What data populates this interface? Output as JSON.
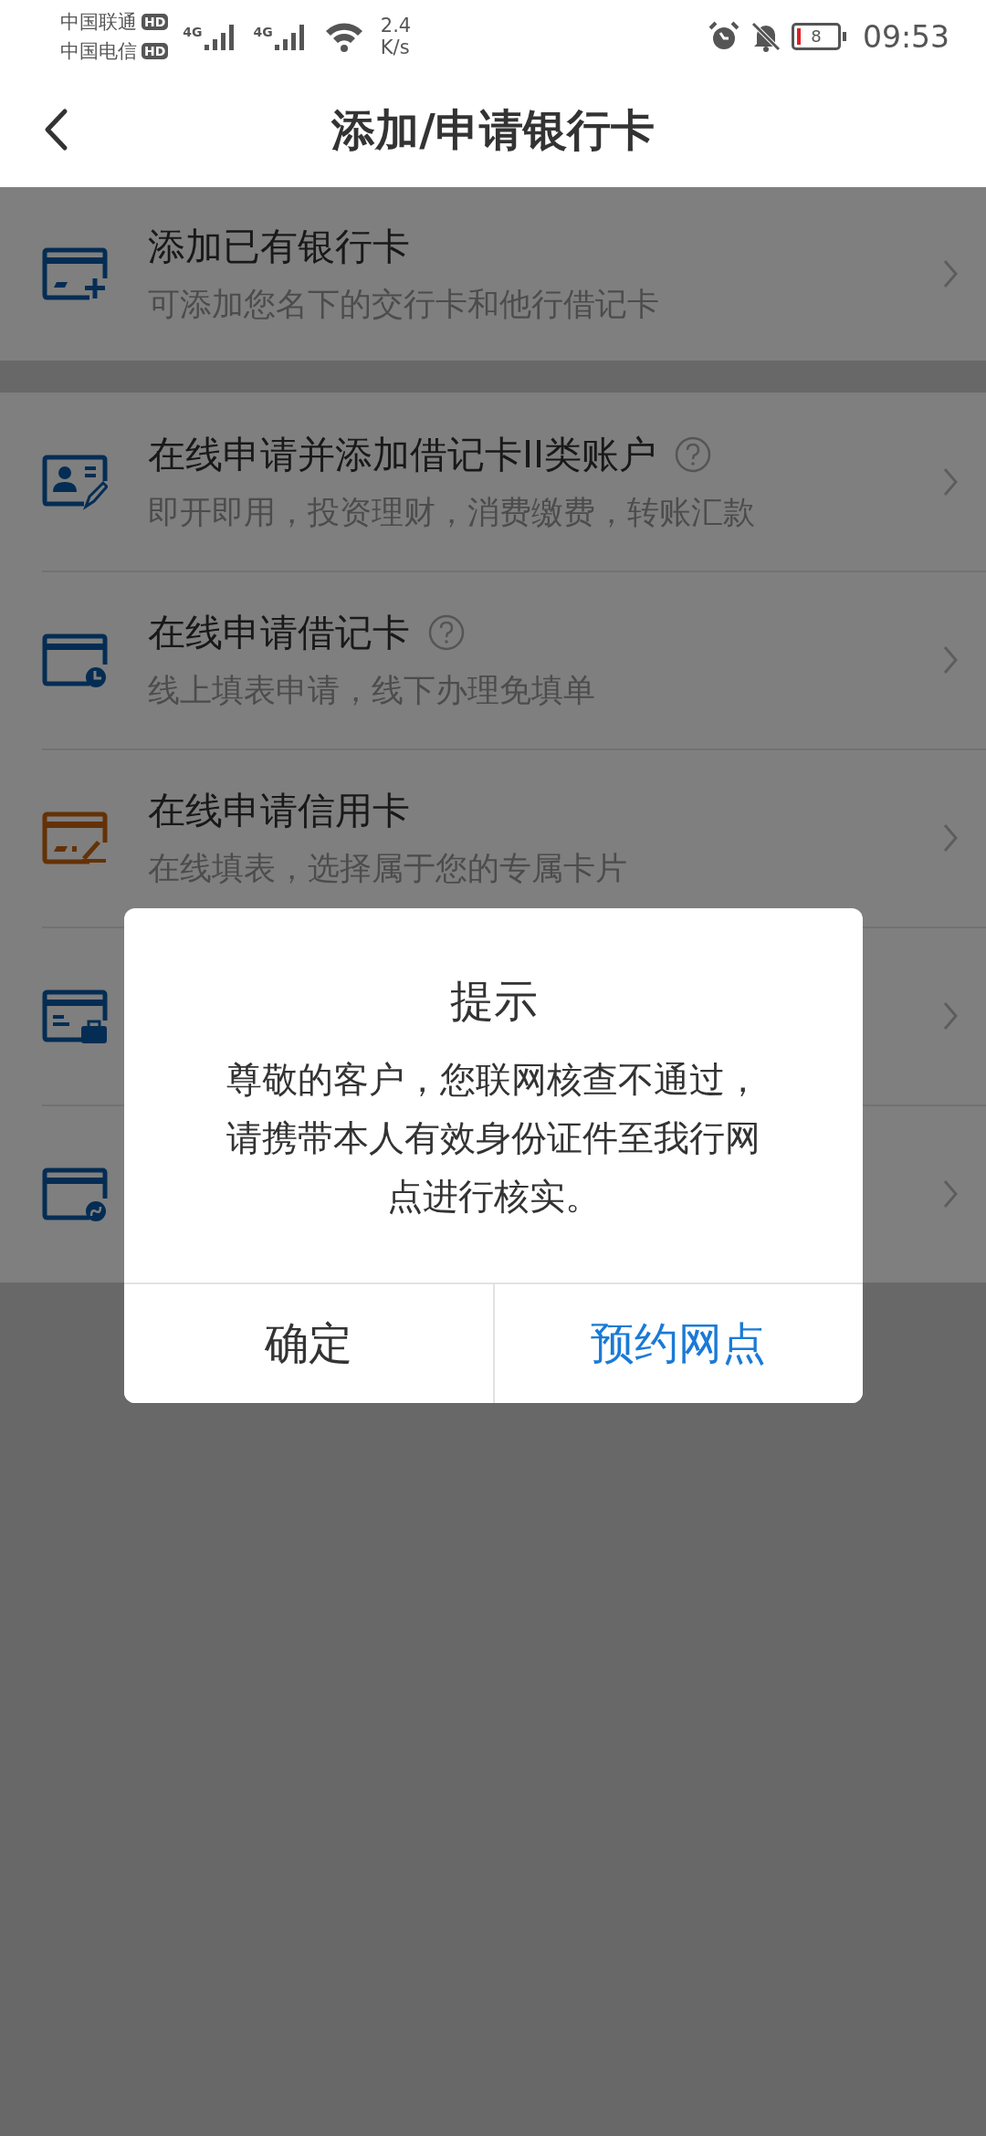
{
  "status_bar": {
    "carriers": [
      {
        "name": "中国联通",
        "badge": "HD"
      },
      {
        "name": "中国电信",
        "badge": "HD"
      }
    ],
    "signals": [
      {
        "label": "4G"
      },
      {
        "label": "4G"
      }
    ],
    "speed": {
      "value": "2.4",
      "unit": "K/s"
    },
    "battery": {
      "level": 0.08,
      "text": "8"
    },
    "time": "09:53"
  },
  "header": {
    "title": "添加/申请银行卡"
  },
  "sections": [
    [
      {
        "title": "添加已有银行卡",
        "subtitle": "可添加您名下的交行卡和他行借记卡",
        "help": false
      }
    ],
    [
      {
        "title": "在线申请并添加借记卡II类账户",
        "subtitle": "即开即用，投资理财，消费缴费，转账汇款",
        "help": true
      },
      {
        "title": "在线申请借记卡",
        "subtitle": "线上填表申请，线下办理免填单",
        "help": true
      },
      {
        "title": "在线申请信用卡",
        "subtitle": "在线填表，选择属于您的专属卡片",
        "help": false
      },
      {
        "help": false
      },
      {
        "help": false
      }
    ]
  ],
  "dialog": {
    "title": "提示",
    "message": "尊敬的客户，您联网核查不通过，请携带本人有效身份证件至我行网点进行核实。",
    "buttons": [
      {
        "label": "确定",
        "kind": "default"
      },
      {
        "label": "预约网点",
        "kind": "primary"
      }
    ]
  }
}
